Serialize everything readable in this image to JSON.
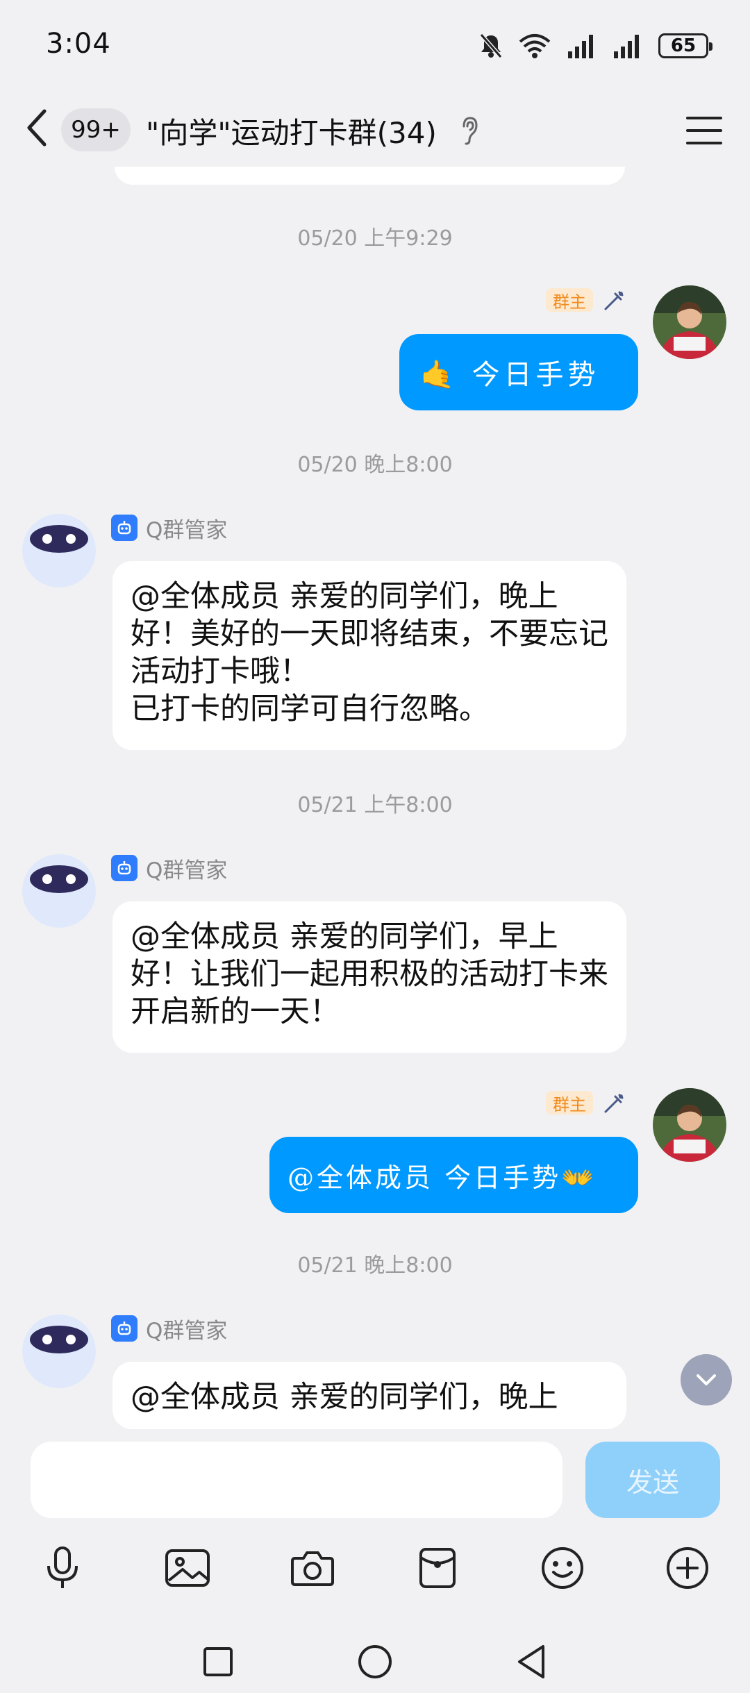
{
  "status_bar": {
    "time": "3:04",
    "battery": "65"
  },
  "header": {
    "unread_count": "99+",
    "title": "\"向学\"运动打卡群(34)"
  },
  "messages": [
    {
      "timestamp": "05/20 上午9:29"
    },
    {
      "badge": "群主",
      "text": "🤙 今日手势"
    },
    {
      "timestamp": "05/20 晚上8:00"
    },
    {
      "sender": "Q群管家",
      "text": "@全体成员 亲爱的同学们，晚上好！美好的一天即将结束，不要忘记活动打卡哦！\n已打卡的同学可自行忽略。"
    },
    {
      "timestamp": "05/21 上午8:00"
    },
    {
      "sender": "Q群管家",
      "text": "@全体成员 亲爱的同学们，早上好！让我们一起用积极的活动打卡来开启新的一天！"
    },
    {
      "badge": "群主",
      "text": "@全体成员 今日手势👐"
    },
    {
      "timestamp": "05/21 晚上8:00"
    },
    {
      "sender": "Q群管家",
      "text": "@全体成员 亲爱的同学们，晚上"
    }
  ],
  "input": {
    "value": "",
    "send_label": "发送"
  },
  "colors": {
    "accent": "#0099ff",
    "background": "#f1f1f3",
    "owner_badge": "#f08a1c",
    "send_disabled": "#8fd0fb"
  }
}
